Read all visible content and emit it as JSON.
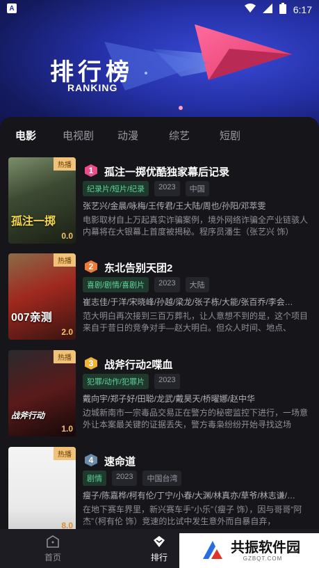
{
  "status": {
    "app_letter": "A",
    "time": "6:17"
  },
  "hero": {
    "title": "排行榜",
    "subtitle": "RANKING"
  },
  "tabs": [
    {
      "label": "电影",
      "active": true
    },
    {
      "label": "电视剧",
      "active": false
    },
    {
      "label": "动漫",
      "active": false
    },
    {
      "label": "综艺",
      "active": false
    },
    {
      "label": "短剧",
      "active": false
    }
  ],
  "items": [
    {
      "rank": "1",
      "rank_color": "#e94d8a",
      "hot": "热播",
      "score": "0.0",
      "poster_text": "孤注一掷",
      "title": "孤注一掷优酷独家幕后记录",
      "genre": "纪录片/短片/纪录",
      "year": "2023",
      "region": "中国",
      "cast": "张艺兴/金晨/咏梅/王传君/王大陆/周也/孙阳/邓萃雯",
      "desc": "电影取材自上万起真实诈骗案例，境外网络诈骗全产业链骇人内幕将在大银幕上首度被揭秘。程序员潘生（张艺兴 饰）"
    },
    {
      "rank": "2",
      "rank_color": "#f07a3a",
      "hot": "热播",
      "score": "2.0",
      "poster_text": "007亲测",
      "title": "东北告别天团2",
      "genre": "喜剧/剧情/喜剧片",
      "year": "2023",
      "region": "大陆",
      "cast": "崔志佳/于洋/宋晓峰/孙越/梁龙/张子栋/大能/张百乔/李会…",
      "desc": "范大明白再次接到三百万葬礼，让人意想不到的是，这个项目来自于昔日的竞争对手—赵大明白。但众人时间、地点、"
    },
    {
      "rank": "3",
      "rank_color": "#f0b43a",
      "hot": "热播",
      "score": "1.0",
      "poster_text": "战斧行动",
      "title": "战斧行动2喋血",
      "genre": "犯罪/动作/犯罪片",
      "year": "2023",
      "region": "",
      "cast": "戴向宇/郑子好/田聪/龙武/戴昊天/桥曜娜/赵中华",
      "desc": "边城新南市一宗毒品交易正在警方的秘密监控下进行，一场意外让本案最关键的证据丢失，警方毒枭纷纷开始寻找这场"
    },
    {
      "rank": "4",
      "rank_color": "#6b8aa8",
      "hot": "热播",
      "score": "8.0",
      "poster_text": "",
      "title": "速命道",
      "genre": "剧情",
      "year": "2023",
      "region": "中国台湾",
      "cast": "瘦子/陈嘉桦/柯有伦/丁宁/小春/大渊/林真亦/草爷/林志谦/…",
      "desc": "在地下赛车界里，新兴赛车手“小乐”（瘦子 饰），因与哥哥“阿杰”（柯有伦 饰）竞速的比试中发生意外而自暴自弃，"
    }
  ],
  "nav": [
    {
      "label": "首页",
      "active": false
    },
    {
      "label": "排行",
      "active": true
    }
  ],
  "watermark": {
    "name": "共振软件园",
    "domain": "GZBQT.COM"
  },
  "colors": {
    "accent_genre": "#5fd39a",
    "hot_tag": "#f0c27a",
    "score": "#f5c36a"
  }
}
